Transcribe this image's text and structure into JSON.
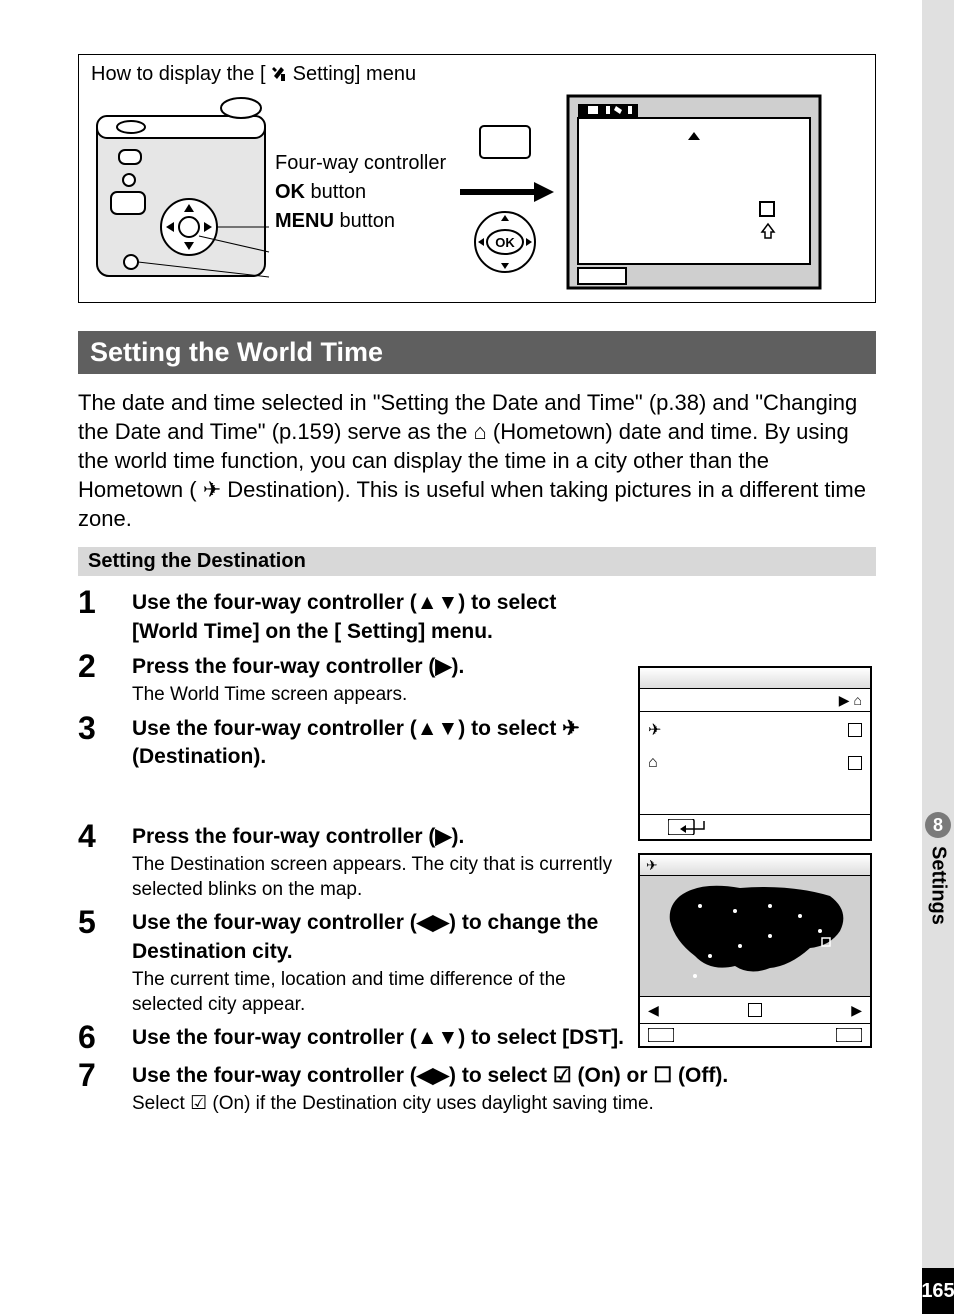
{
  "sidebar": {
    "chapter_number": "8",
    "chapter_label": "Settings",
    "page_number": "165"
  },
  "howto": {
    "title_prefix": "How to display the [",
    "title_suffix": " Setting] menu",
    "label_fourway": "Four-way controller",
    "label_ok_bold": "OK",
    "label_ok_suffix": " button",
    "label_menu_bold": "MENU",
    "label_menu_suffix": " button"
  },
  "heading": "Setting the World Time",
  "intro": "The date and time selected in \"Setting the Date and Time\" (p.38) and \"Changing the Date and Time\" (p.159) serve as the ⌂ (Hometown) date and time. By using the world time function, you can display the time in a city other than the Hometown ( ✈ Destination). This is useful when taking pictures in a different time zone.",
  "subheading": "Setting the Destination",
  "steps": [
    {
      "num": "1",
      "title": "Use the four-way controller (▲▼) to select [World Time] on the [   Setting] menu."
    },
    {
      "num": "2",
      "title": "Press the four-way controller (▶).",
      "desc": "The World Time screen appears."
    },
    {
      "num": "3",
      "title": "Use the four-way controller (▲▼) to select ✈ (Destination)."
    },
    {
      "num": "4",
      "title": "Press the four-way controller (▶).",
      "desc": "The Destination screen appears. The city that is currently selected blinks on the map."
    },
    {
      "num": "5",
      "title": "Use the four-way controller (◀▶) to change the Destination city.",
      "desc": "The current time, location and time difference of the selected city appear."
    },
    {
      "num": "6",
      "title": "Use the four-way controller (▲▼) to select [DST]."
    },
    {
      "num": "7",
      "title": "Use the four-way controller (◀▶) to select ☑ (On) or ☐ (Off).",
      "desc": "Select ☑ (On) if the Destination city uses daylight saving time."
    }
  ]
}
